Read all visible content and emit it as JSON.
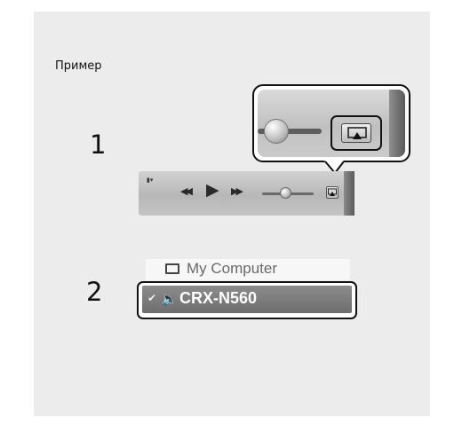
{
  "caption": "Пример",
  "steps": {
    "one": "1",
    "two": "2"
  },
  "icons": {
    "sidebar_toggle": "sidebar-toggle-icon",
    "rewind": "rewind-icon",
    "play": "play-icon",
    "fast_forward": "fast-forward-icon",
    "volume": "volume-slider",
    "airplay": "airplay-icon",
    "monitor": "monitor-icon",
    "speaker": "speaker-icon",
    "check": "check-icon"
  },
  "volume_level": 0.45,
  "device_list": {
    "items": [
      {
        "label": "My Computer",
        "selected": false
      },
      {
        "label": "CRX-N560",
        "selected": true
      }
    ]
  },
  "colors": {
    "panel_bg": "#ececec",
    "highlight_row": "#7a7a7a",
    "frame": "#111111"
  }
}
